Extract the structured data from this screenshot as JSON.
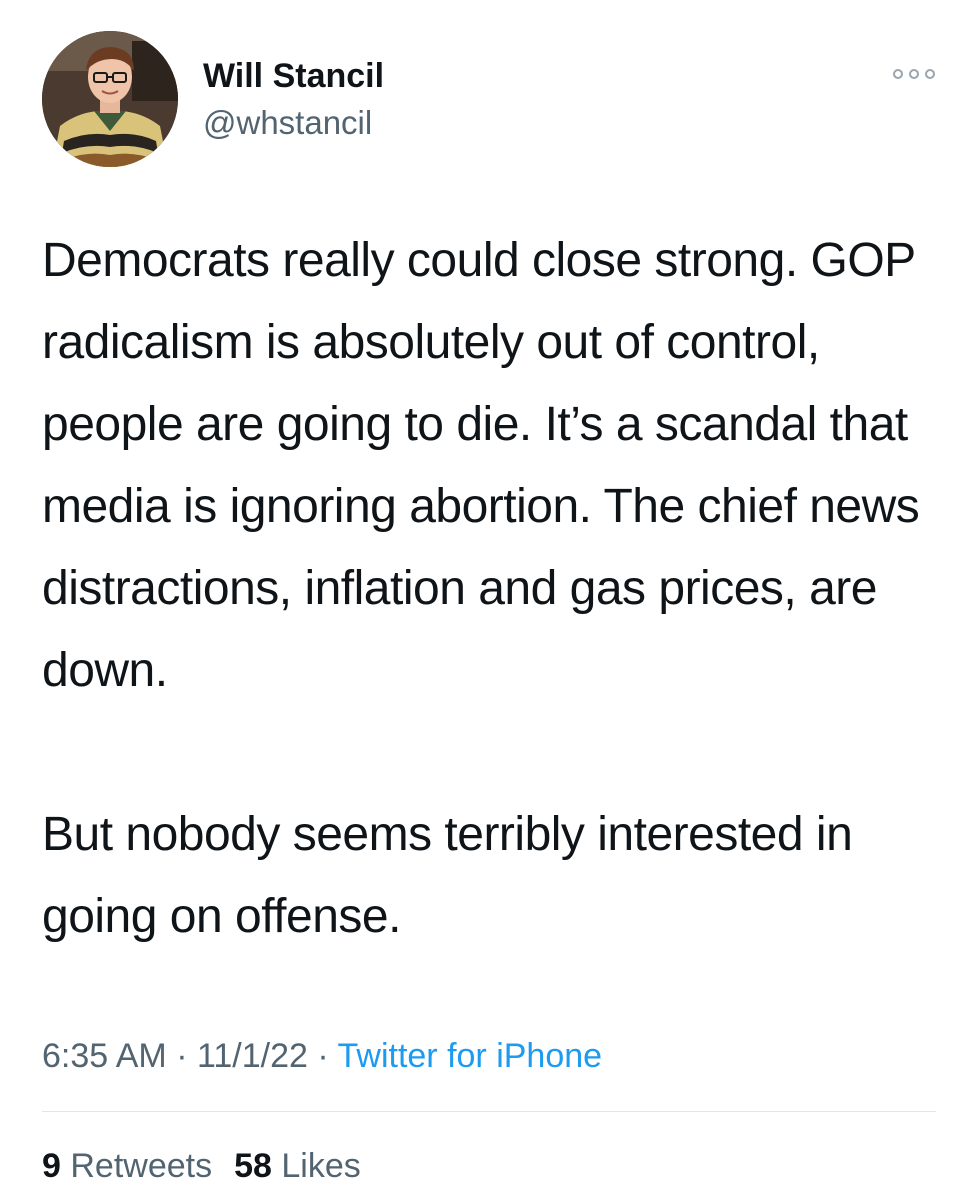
{
  "author": {
    "display_name": "Will Stancil",
    "handle": "@whstancil",
    "avatar_icon": "user-avatar-photo"
  },
  "more_icon": "more-horizontal-icon",
  "tweet": {
    "paragraphs": [
      "Democrats really could close strong. GOP radicalism is absolutely out of control, people are going to die. It’s a scandal that media is ignoring abortion. The chief news distractions, inflation and gas prices, are down.",
      "But nobody seems terribly interested in going on offense."
    ]
  },
  "meta": {
    "time": "6:35 AM",
    "separator": " · ",
    "date": "11/1/22",
    "source": "Twitter for iPhone"
  },
  "stats": {
    "retweets_count": "9",
    "retweets_label": "Retweets",
    "likes_count": "58",
    "likes_label": "Likes"
  },
  "colors": {
    "text": "#0f1419",
    "secondary": "#536471",
    "link": "#1d9bf0",
    "divider": "#e1e6ea"
  }
}
